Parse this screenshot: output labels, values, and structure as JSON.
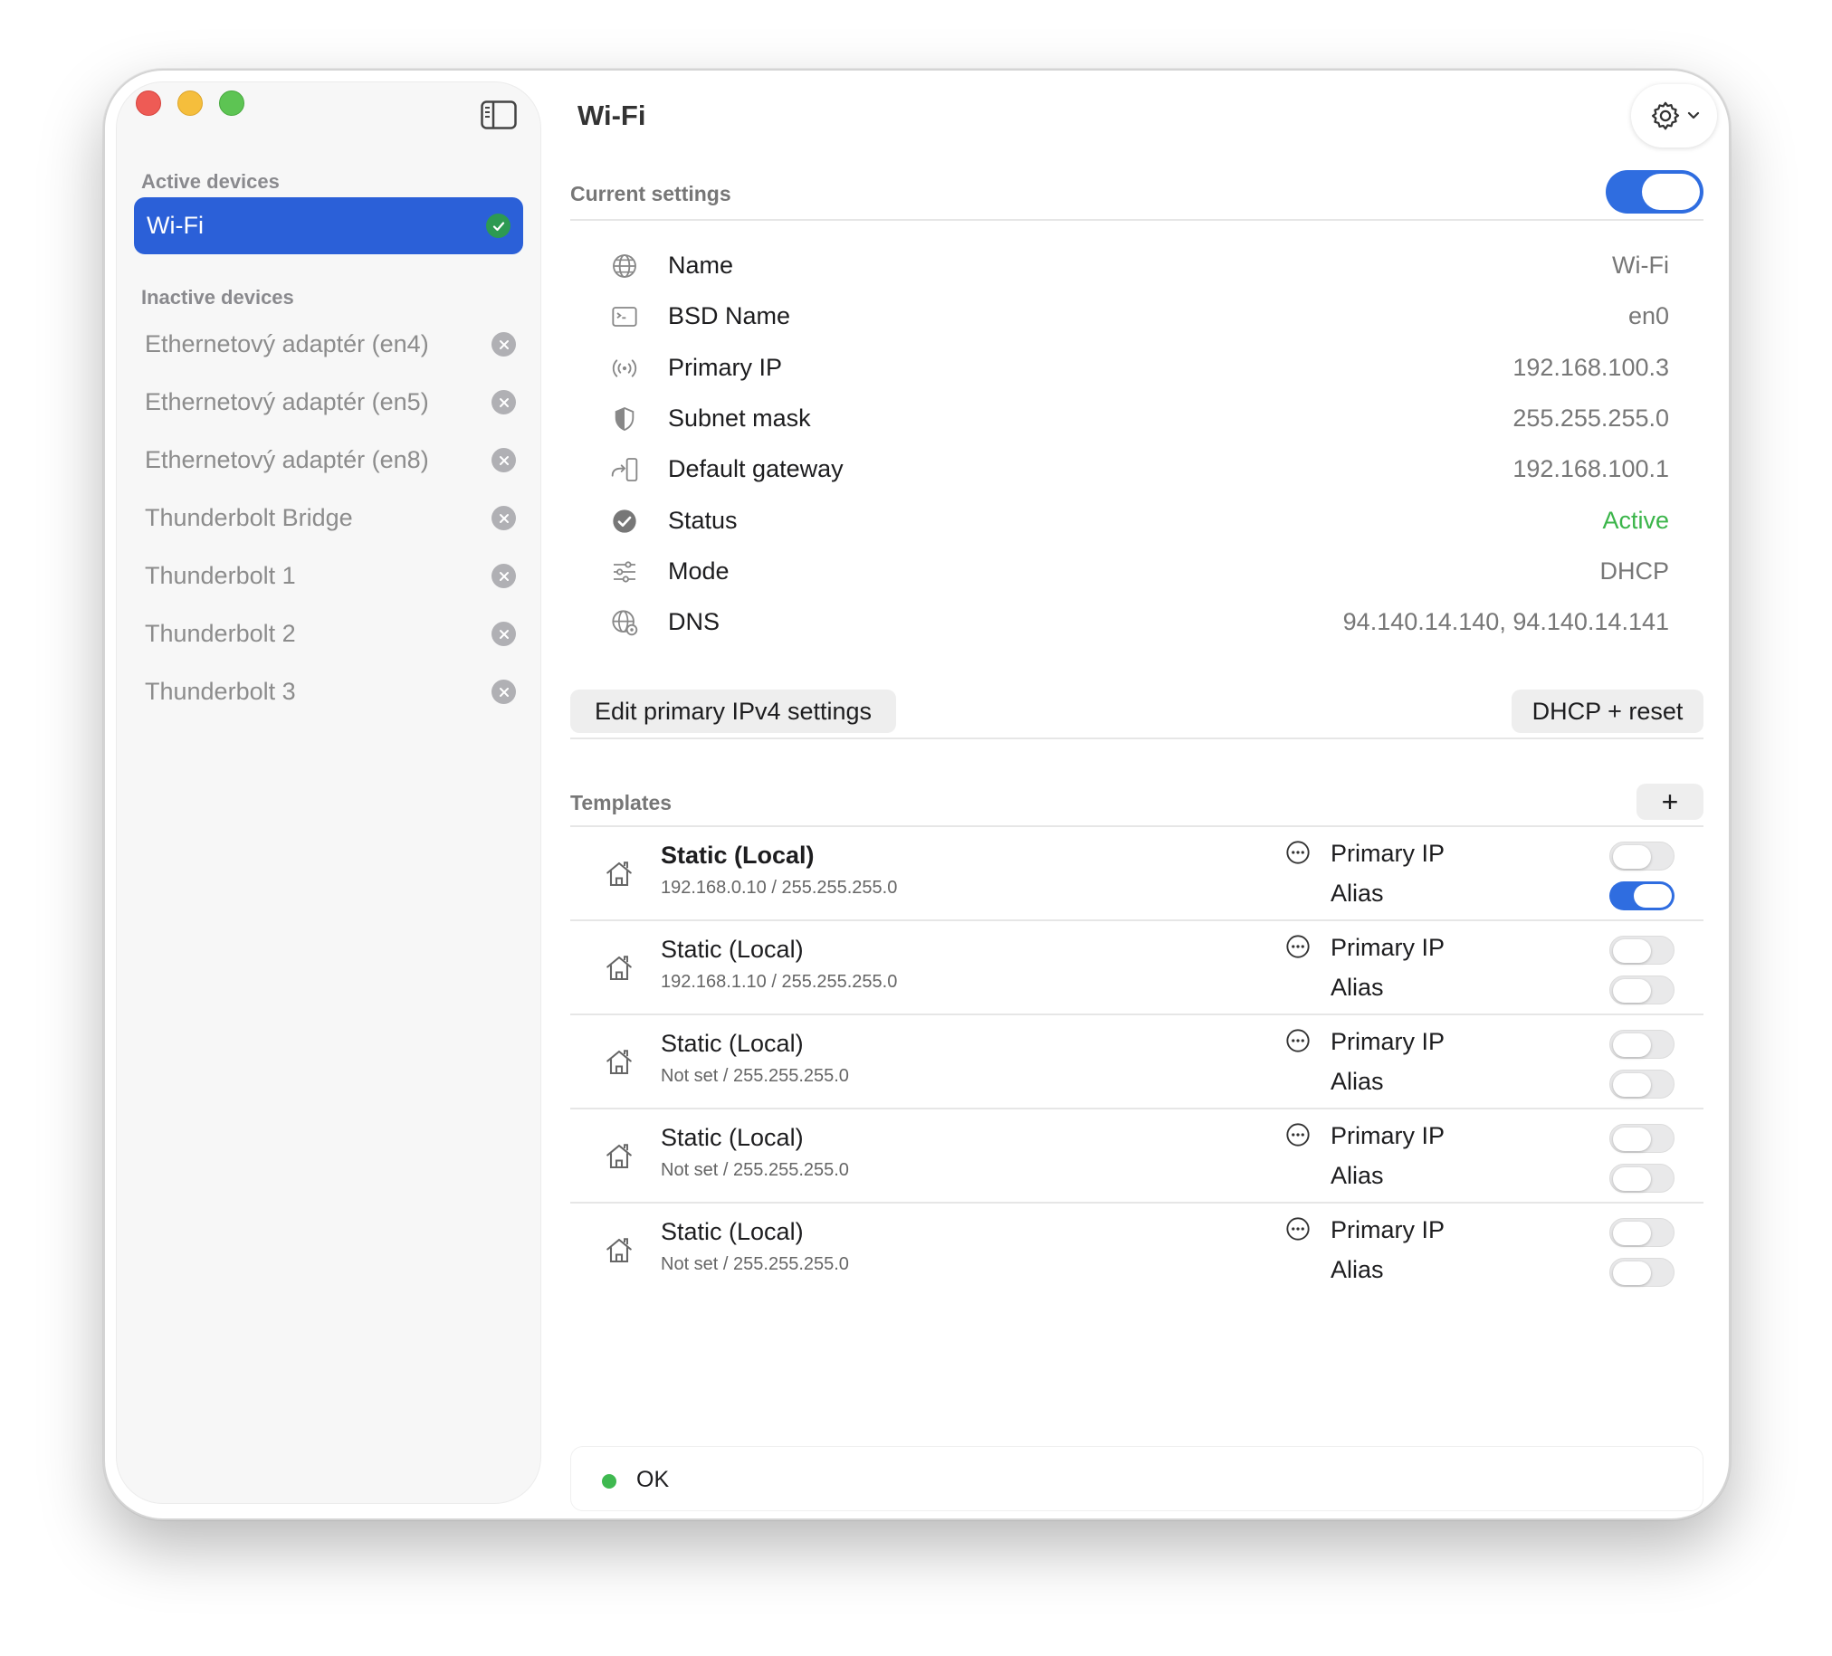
{
  "sidebar": {
    "active_title": "Active devices",
    "active_item": "Wi-Fi",
    "inactive_title": "Inactive devices",
    "inactive_items": [
      "Ethernetový adaptér (en4)",
      "Ethernetový adaptér (en5)",
      "Ethernetový adaptér (en8)",
      "Thunderbolt Bridge",
      "Thunderbolt 1",
      "Thunderbolt 2",
      "Thunderbolt 3"
    ]
  },
  "main": {
    "title": "Wi-Fi",
    "current_settings_title": "Current settings",
    "current_settings_enabled": true,
    "info": [
      {
        "icon": "globe-icon",
        "label": "Name",
        "value": "Wi-Fi"
      },
      {
        "icon": "terminal-icon",
        "label": "BSD Name",
        "value": "en0"
      },
      {
        "icon": "antenna-icon",
        "label": "Primary IP",
        "value": "192.168.100.3"
      },
      {
        "icon": "shield-icon",
        "label": "Subnet mask",
        "value": "255.255.255.0"
      },
      {
        "icon": "gateway-icon",
        "label": "Default gateway",
        "value": "192.168.100.1"
      },
      {
        "icon": "checkmark-circle-icon",
        "label": "Status",
        "value": "Active"
      },
      {
        "icon": "sliders-icon",
        "label": "Mode",
        "value": "DHCP"
      },
      {
        "icon": "dns-globe-icon",
        "label": "DNS",
        "value": "94.140.14.140, 94.140.14.141"
      }
    ],
    "edit_button": "Edit primary IPv4 settings",
    "dhcp_button": "DHCP + reset",
    "templates_title": "Templates",
    "add_button": "+",
    "templates": [
      {
        "name": "Static (Local)",
        "sub": "192.168.0.10 / 255.255.255.0",
        "primary_label": "Primary IP",
        "alias_label": "Alias",
        "primary_on": false,
        "alias_on": true
      },
      {
        "name": "Static (Local)",
        "sub": "192.168.1.10 / 255.255.255.0",
        "primary_label": "Primary IP",
        "alias_label": "Alias",
        "primary_on": false,
        "alias_on": false
      },
      {
        "name": "Static (Local)",
        "sub": "Not set / 255.255.255.0",
        "primary_label": "Primary IP",
        "alias_label": "Alias",
        "primary_on": false,
        "alias_on": false
      },
      {
        "name": "Static (Local)",
        "sub": "Not set / 255.255.255.0",
        "primary_label": "Primary IP",
        "alias_label": "Alias",
        "primary_on": false,
        "alias_on": false
      },
      {
        "name": "Static (Local)",
        "sub": "Not set / 255.255.255.0",
        "primary_label": "Primary IP",
        "alias_label": "Alias",
        "primary_on": false,
        "alias_on": false
      }
    ],
    "status_text": "OK"
  },
  "colors": {
    "accent": "#2b60d8",
    "active_status": "#3bb54a",
    "ok_dot": "#3fb950"
  }
}
